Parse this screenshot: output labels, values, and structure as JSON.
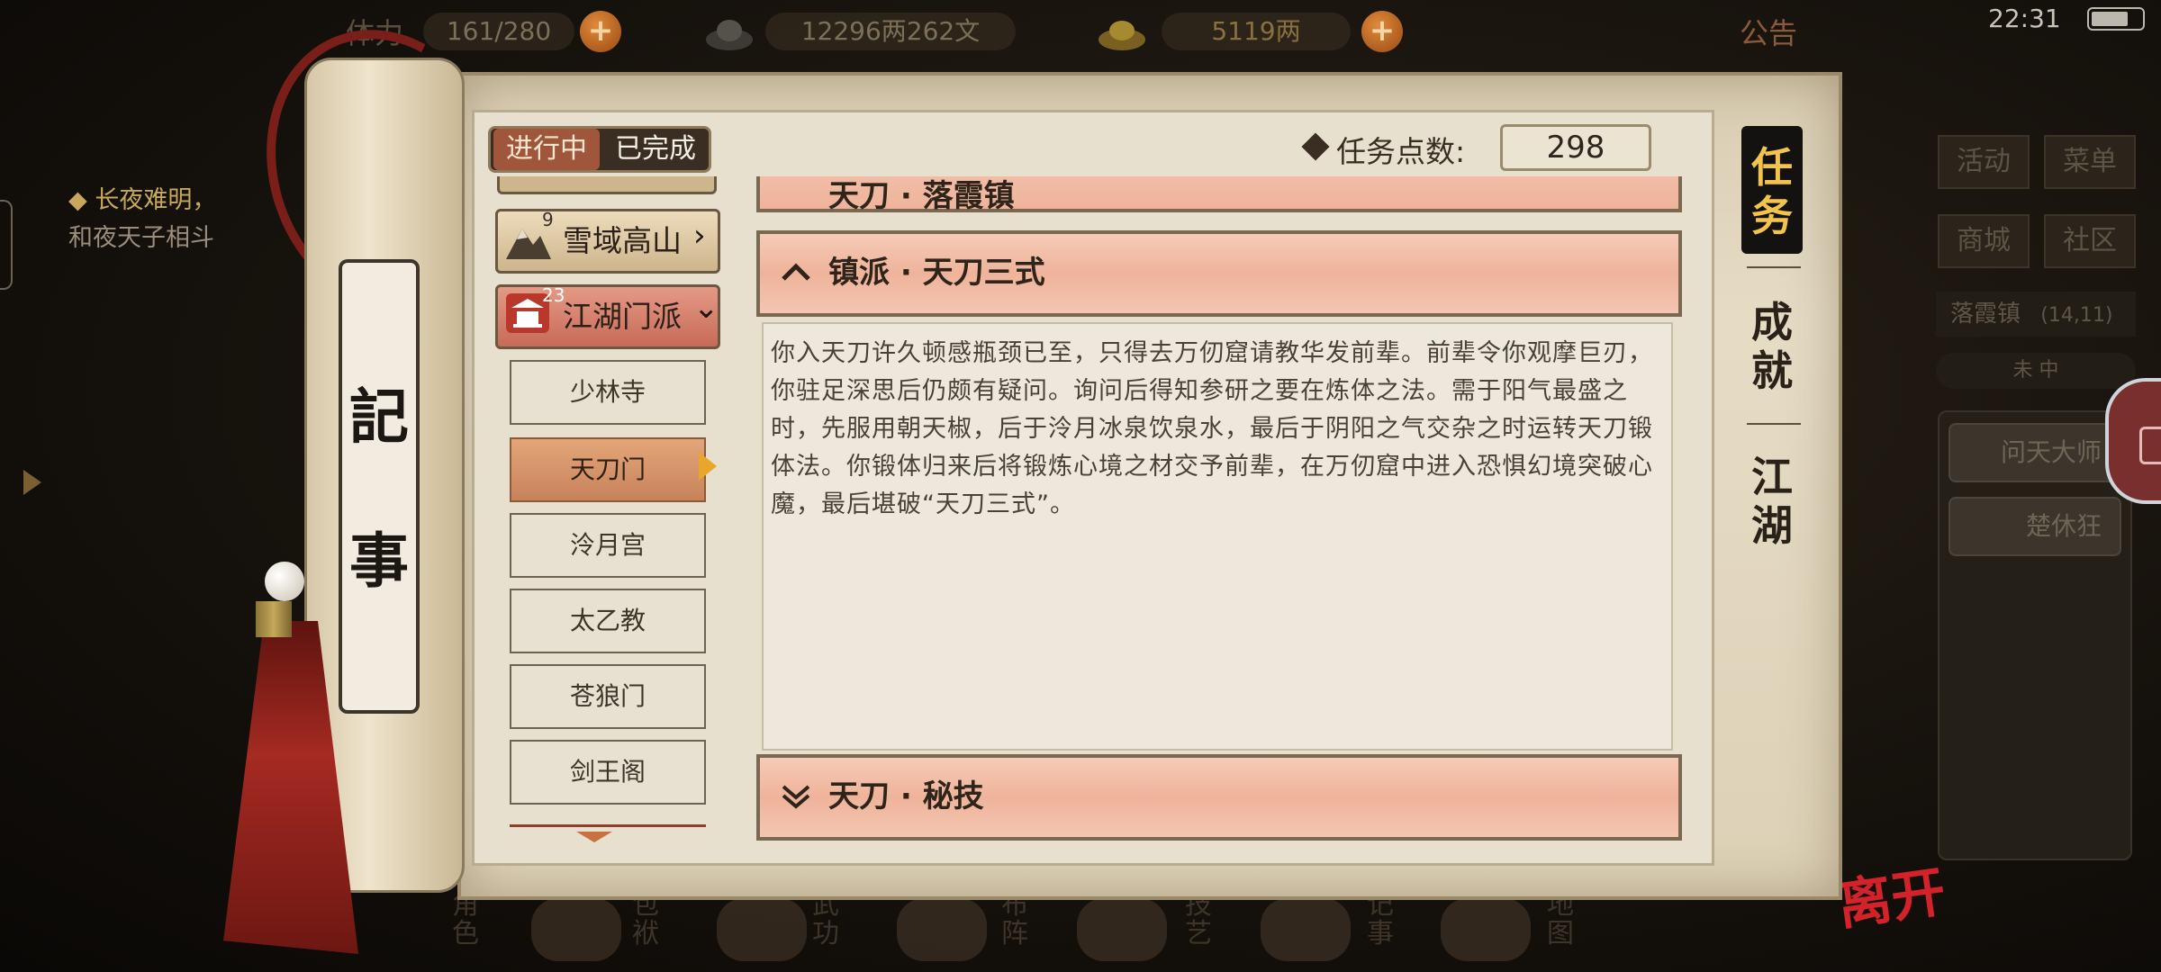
{
  "topbar": {
    "stamina": "161/280",
    "stamina_label": "体力",
    "coins": "12296两262文",
    "gold": "5119两",
    "notice": "公告",
    "time": "22:31"
  },
  "hint": {
    "line1": "◆ 长夜难明，",
    "line2": "和夜天子相斗"
  },
  "right_panel": {
    "buttons": [
      "活动",
      "菜单",
      "商城",
      "社区"
    ],
    "location": "落霞镇",
    "coords": "(14,11)",
    "time_state": "未  中",
    "npcs": [
      "问天大师",
      "楚休狂"
    ]
  },
  "bottom_menu": [
    "角色",
    "包袱",
    "武功",
    "布阵",
    "技艺",
    "记事",
    "地图"
  ],
  "leave": "离开",
  "scroll": {
    "char1": "記",
    "char2": "事"
  },
  "journal": {
    "tab_in_progress": "进行中",
    "tab_done": "已完成",
    "points_label": "任务点数:",
    "points_value": "298",
    "categories": [
      {
        "label": "雪域高山",
        "count": "9",
        "arrow": "›"
      },
      {
        "label": "江湖门派",
        "count": "23",
        "arrow": "⌄"
      }
    ],
    "sub_items": [
      "少林寺",
      "天刀门",
      "泠月宫",
      "太乙教",
      "苍狼门",
      "剑王阁"
    ],
    "selected_sub": "天刀门",
    "quests": [
      {
        "title": "天刀 · 落霞镇"
      },
      {
        "title": "镇派 · 天刀三式"
      },
      {
        "title": "天刀 · 秘技"
      }
    ],
    "quest_text": "你入天刀许久顿感瓶颈已至，只得去万仞窟请教华发前辈。前辈令你观摩巨刃，你驻足深思后仍颇有疑问。询问后得知参研之要在炼体之法。需于阳气最盛之时，先服用朝天椒，后于泠月冰泉饮泉水，最后于阴阳之气交杂之时运转天刀锻体法。你锻体归来后将锻炼心境之材交予前辈，在万仞窟中进入恐惧幻境突破心魔，最后堪破“天刀三式”。"
  },
  "tabs": {
    "task": [
      "任",
      "务"
    ],
    "achievement": [
      "成",
      "就"
    ],
    "world": [
      "江",
      "湖"
    ]
  },
  "colors": {
    "accent_red": "#c86a58",
    "selected_orange": "#c8825a",
    "quest_header": "#efb39b",
    "leave_red": "#d3222a"
  }
}
